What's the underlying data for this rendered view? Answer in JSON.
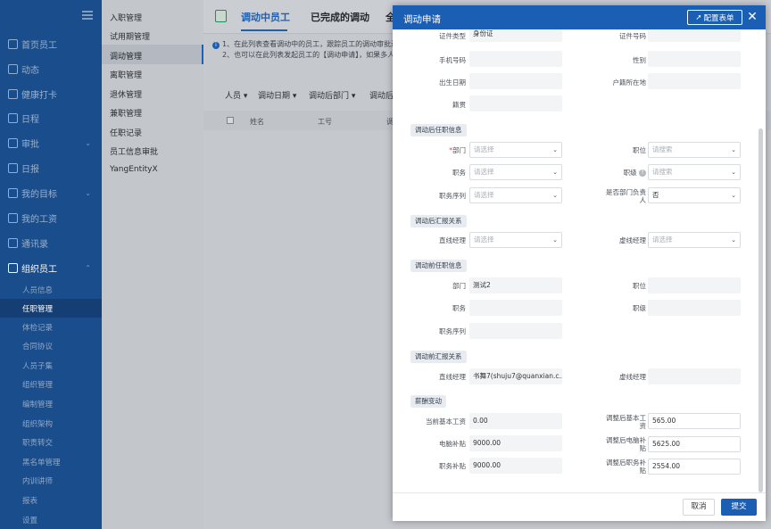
{
  "sidebar": {
    "items": [
      {
        "label": "首页员工",
        "icon": "home-icon"
      },
      {
        "label": "动态",
        "icon": "feed-icon"
      },
      {
        "label": "健康打卡",
        "icon": "health-icon"
      },
      {
        "label": "日程",
        "icon": "calendar-icon"
      },
      {
        "label": "审批",
        "icon": "approval-icon"
      },
      {
        "label": "日报",
        "icon": "report-icon"
      },
      {
        "label": "我的目标",
        "icon": "target-icon"
      },
      {
        "label": "我的工资",
        "icon": "salary-icon"
      },
      {
        "label": "通讯录",
        "icon": "contacts-icon"
      },
      {
        "label": "组织员工",
        "icon": "org-icon"
      }
    ],
    "subitems": [
      "人员信息",
      "任职管理",
      "体检记录",
      "合同协议",
      "人员子集",
      "组织管理",
      "编制管理",
      "组织架构",
      "职责转交",
      "黑名单管理",
      "内训讲师",
      "报表",
      "设置"
    ]
  },
  "panel2": {
    "items": [
      "入职管理",
      "试用期管理",
      "调动管理",
      "离职管理",
      "退休管理",
      "兼职管理",
      "任职记录",
      "员工信息审批",
      "YangEntityX"
    ]
  },
  "main": {
    "tabs": [
      "调动中员工",
      "已完成的调动",
      "全"
    ],
    "notice_1": "1、在此列表查看调动中的员工，跟踪员工的调动审批进",
    "notice_2": "2、也可以在此列表发起员工的【调动申请】，如果多人",
    "filters": [
      "人员 ▾",
      "调动日期 ▾",
      "调动后部门 ▾",
      "调动后"
    ],
    "columns": [
      "姓名",
      "工号",
      "调"
    ]
  },
  "modal": {
    "title": "调动申请",
    "config_label": "配置表单",
    "close_icon": "close-icon",
    "fields": {
      "id_type_label": "证件类型",
      "id_type_value": "身份证",
      "id_no_label": "证件号码",
      "id_no_value": "",
      "phone_label": "手机号码",
      "phone_value": "",
      "gender_label": "性别",
      "gender_value": "",
      "birth_label": "出生日期",
      "birth_value": "",
      "hukou_label": "户籍所在地",
      "hukou_value": "",
      "native_label": "籍贯",
      "native_value": ""
    },
    "sections": {
      "after_job": "调动后任职信息",
      "after_report": "调动后汇报关系",
      "before_job": "调动前任职信息",
      "before_report": "调动前汇报关系",
      "salary": "薪酬变动"
    },
    "after_job": {
      "dept_label": "部门",
      "dept_placeholder": "请选择",
      "position_label": "职位",
      "position_placeholder": "请搜索",
      "duty_label": "职务",
      "duty_placeholder": "请选择",
      "level_label": "职级",
      "level_placeholder": "请搜索",
      "seq_label": "职务序列",
      "seq_placeholder": "请选择",
      "head_label": "是否部门负责人",
      "head_value": "否"
    },
    "after_report": {
      "direct_label": "直线经理",
      "direct_placeholder": "请选择",
      "virtual_label": "虚线经理",
      "virtual_placeholder": "请选择"
    },
    "before_job": {
      "dept_label": "部门",
      "dept_value": "测试2",
      "position_label": "职位",
      "position_value": "",
      "duty_label": "职务",
      "duty_value": "",
      "level_label": "职级",
      "level_value": "",
      "seq_label": "职务序列",
      "seq_value": ""
    },
    "before_report": {
      "direct_label": "直线经理",
      "direct_value": "书舞7(shuju7@quanxian.c...",
      "virtual_label": "虚线经理",
      "virtual_value": ""
    },
    "salary": {
      "base_label": "当前基本工资",
      "base_value": "0.00",
      "base_after_label": "调整后基本工资",
      "base_after_value": "565.00",
      "pc_label": "电脑补贴",
      "pc_value": "9000.00",
      "pc_after_label": "调整后电脑补贴",
      "pc_after_value": "5625.00",
      "duty_label": "职务补贴",
      "duty_value": "9000.00",
      "duty_after_label": "调整后职务补贴",
      "duty_after_value": "2554.00"
    },
    "cancel_label": "取消",
    "submit_label": "提交"
  },
  "colors": {
    "sidebar": "#1a4d8c",
    "primary": "#1a5fb4",
    "required": "#e23c3c"
  }
}
